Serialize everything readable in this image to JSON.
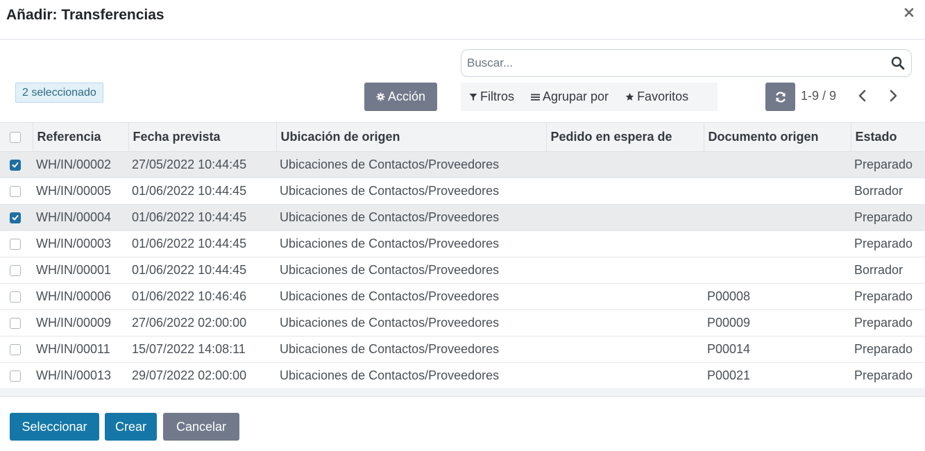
{
  "dialog": {
    "title": "Añadir: Transferencias"
  },
  "selection": {
    "badge": "2 seleccionado"
  },
  "search": {
    "placeholder": "Buscar..."
  },
  "toolbar": {
    "action_label": "Acción",
    "filters_label": "Filtros",
    "groupby_label": "Agrupar por",
    "favorites_label": "Favoritos",
    "pager_text": "1-9 / 9"
  },
  "table": {
    "columns": [
      "Referencia",
      "Fecha prevista",
      "Ubicación de origen",
      "Pedido en espera de",
      "Documento origen",
      "Estado"
    ],
    "rows": [
      {
        "checked": true,
        "ref": "WH/IN/00002",
        "date": "27/05/2022 10:44:45",
        "origin": "Ubicaciones de Contactos/Proveedores",
        "backorder": "",
        "doc": "",
        "state": "Preparado"
      },
      {
        "checked": false,
        "ref": "WH/IN/00005",
        "date": "01/06/2022 10:44:45",
        "origin": "Ubicaciones de Contactos/Proveedores",
        "backorder": "",
        "doc": "",
        "state": "Borrador"
      },
      {
        "checked": true,
        "ref": "WH/IN/00004",
        "date": "01/06/2022 10:44:45",
        "origin": "Ubicaciones de Contactos/Proveedores",
        "backorder": "",
        "doc": "",
        "state": "Preparado"
      },
      {
        "checked": false,
        "ref": "WH/IN/00003",
        "date": "01/06/2022 10:44:45",
        "origin": "Ubicaciones de Contactos/Proveedores",
        "backorder": "",
        "doc": "",
        "state": "Preparado"
      },
      {
        "checked": false,
        "ref": "WH/IN/00001",
        "date": "01/06/2022 10:44:45",
        "origin": "Ubicaciones de Contactos/Proveedores",
        "backorder": "",
        "doc": "",
        "state": "Borrador"
      },
      {
        "checked": false,
        "ref": "WH/IN/00006",
        "date": "01/06/2022 10:46:46",
        "origin": "Ubicaciones de Contactos/Proveedores",
        "backorder": "",
        "doc": "P00008",
        "state": "Preparado"
      },
      {
        "checked": false,
        "ref": "WH/IN/00009",
        "date": "27/06/2022 02:00:00",
        "origin": "Ubicaciones de Contactos/Proveedores",
        "backorder": "",
        "doc": "P00009",
        "state": "Preparado"
      },
      {
        "checked": false,
        "ref": "WH/IN/00011",
        "date": "15/07/2022 14:08:11",
        "origin": "Ubicaciones de Contactos/Proveedores",
        "backorder": "",
        "doc": "P00014",
        "state": "Preparado"
      },
      {
        "checked": false,
        "ref": "WH/IN/00013",
        "date": "29/07/2022 02:00:00",
        "origin": "Ubicaciones de Contactos/Proveedores",
        "backorder": "",
        "doc": "P00021",
        "state": "Preparado"
      }
    ]
  },
  "footer": {
    "select_label": "Seleccionar",
    "create_label": "Crear",
    "cancel_label": "Cancelar"
  },
  "colors": {
    "primary": "#1477a8",
    "secondary": "#71798b",
    "badge_bg": "#e2f1f8",
    "selected_row": "#e9ebed"
  },
  "icons": [
    "close-icon",
    "search-icon",
    "gear-icon",
    "filter-icon",
    "groupby-icon",
    "star-icon",
    "refresh-icon",
    "chevron-left-icon",
    "chevron-right-icon",
    "check-icon"
  ]
}
